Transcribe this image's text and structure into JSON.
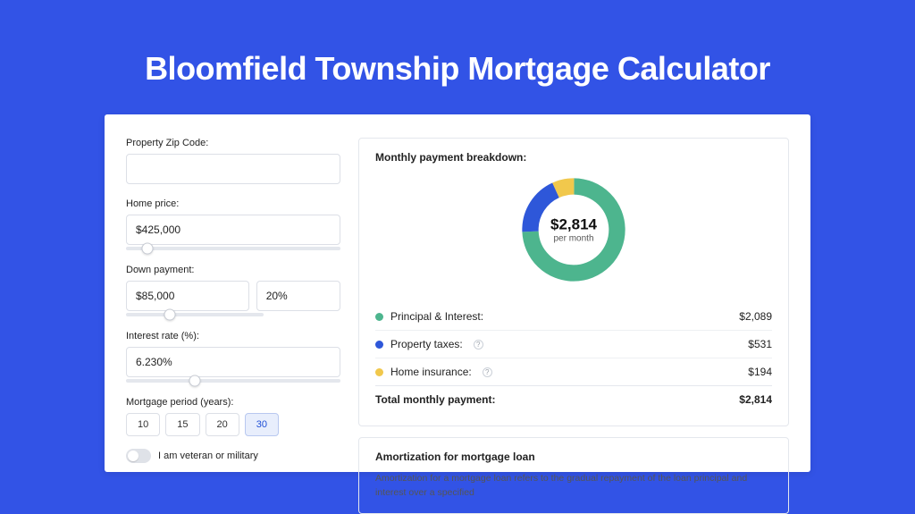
{
  "hero": {
    "title": "Bloomfield Township Mortgage Calculator"
  },
  "form": {
    "zip_label": "Property Zip Code:",
    "zip_value": "",
    "home_price_label": "Home price:",
    "home_price_value": "$425,000",
    "down_payment_label": "Down payment:",
    "down_payment_value": "$85,000",
    "down_payment_pct": "20%",
    "interest_label": "Interest rate (%):",
    "interest_value": "6.230%",
    "period_label": "Mortgage period (years):",
    "period_options": [
      "10",
      "15",
      "20",
      "30"
    ],
    "period_active_index": 3,
    "veteran_label": "I am veteran or military"
  },
  "breakdown": {
    "title": "Monthly payment breakdown:",
    "center_amount": "$2,814",
    "center_sub": "per month",
    "items": [
      {
        "label": "Principal & Interest:",
        "value": "$2,089",
        "color": "#4db58e",
        "help": false
      },
      {
        "label": "Property taxes:",
        "value": "$531",
        "color": "#2e57d9",
        "help": true
      },
      {
        "label": "Home insurance:",
        "value": "$194",
        "color": "#f1c84c",
        "help": true
      }
    ],
    "total_label": "Total monthly payment:",
    "total_value": "$2,814"
  },
  "amort": {
    "title": "Amortization for mortgage loan",
    "text": "Amortization for a mortgage loan refers to the gradual repayment of the loan principal and interest over a specified"
  },
  "chart_data": {
    "type": "pie",
    "title": "Monthly payment breakdown",
    "series": [
      {
        "name": "Principal & Interest",
        "value": 2089,
        "color": "#4db58e"
      },
      {
        "name": "Property taxes",
        "value": 531,
        "color": "#2e57d9"
      },
      {
        "name": "Home insurance",
        "value": 194,
        "color": "#f1c84c"
      }
    ],
    "total": 2814,
    "center_label": "$2,814 per month"
  }
}
